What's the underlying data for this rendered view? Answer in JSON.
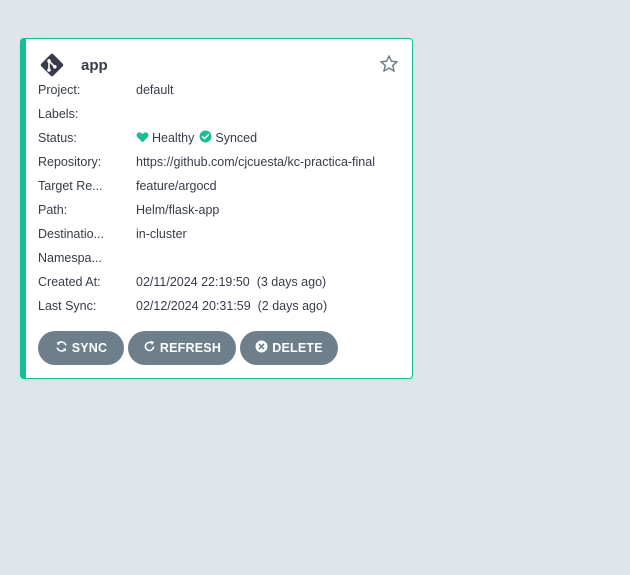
{
  "card": {
    "app_name": "app",
    "icons": {
      "app": "git-icon",
      "favorite": "star-icon"
    },
    "rows": [
      {
        "label": "Project:",
        "value": "default"
      },
      {
        "label": "Labels:",
        "value": ""
      },
      {
        "label": "Status:",
        "health": "Healthy",
        "sync": "Synced"
      },
      {
        "label": "Repository:",
        "value": "https://github.com/cjcuesta/kc-practica-final"
      },
      {
        "label": "Target Re...",
        "value": "feature/argocd"
      },
      {
        "label": "Path:",
        "value": "Helm/flask-app"
      },
      {
        "label": "Destinatio...",
        "value": "in-cluster"
      },
      {
        "label": "Namespa...",
        "value": ""
      },
      {
        "label": "Created At:",
        "value": "02/11/2024 22:19:50  (3 days ago)"
      },
      {
        "label": "Last Sync:",
        "value": "02/12/2024 20:31:59  (2 days ago)"
      }
    ],
    "buttons": {
      "sync": "SYNC",
      "refresh": "REFRESH",
      "delete": "DELETE"
    }
  },
  "colors": {
    "page_background": "#dee6eb",
    "accent_healthy": "#18be94",
    "button_background": "#6d7f8b",
    "text": "#363c4a"
  }
}
